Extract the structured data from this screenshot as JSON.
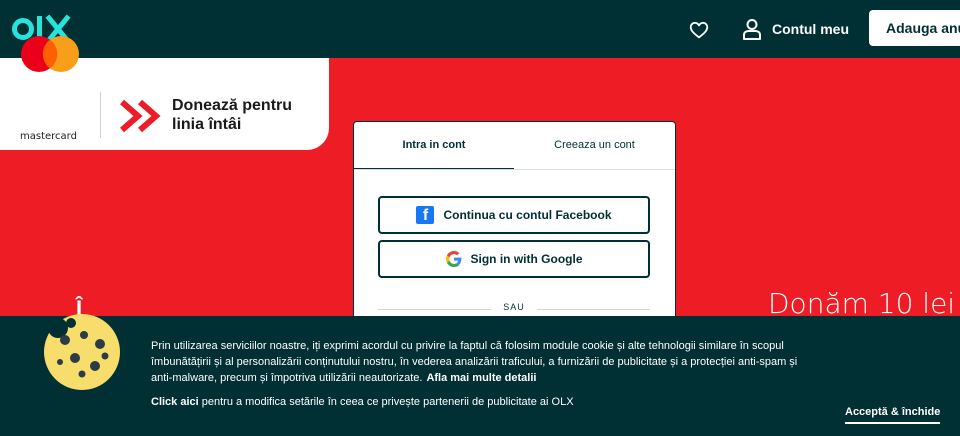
{
  "header": {
    "logo_alt": "olx-logo",
    "favorites_icon": "heart-icon",
    "account_icon": "user-icon",
    "account_label": "Contul meu",
    "post_ad_label": "Adauga anunt"
  },
  "banner": {
    "sponsor_name": "mastercard",
    "campaign_text": "Donează pentru linia întâi",
    "headline_partial": "Î",
    "right_text": "Donăm 10 lei"
  },
  "login": {
    "tabs": [
      {
        "label": "Intra in cont",
        "active": true
      },
      {
        "label": "Creeaza un cont",
        "active": false
      }
    ],
    "facebook_label": "Continua cu contul Facebook",
    "google_label": "Sign in with Google",
    "divider_label": "SAU"
  },
  "cookie_banner": {
    "text": "Prin utilizarea serviciilor noastre, iți exprimi acordul cu privire la faptul că folosim module cookie și alte tehnologii similare în scopul îmbunătățirii și al personalizării conținutului nostru, în vederea analizării traficului, a furnizării de publicitate și a protecției anti-spam și anti-malware, precum și împotriva utilizării neautorizate.",
    "more_details_label": "Afla mai multe detalii",
    "click_here_label": "Click aici",
    "click_here_suffix": "pentru a modifica setările în ceea ce privește partenerii de publicitate ai OLX",
    "accept_label": "Acceptă & închide"
  },
  "colors": {
    "brand_dark": "#002f34",
    "brand_teal": "#23e5db",
    "campaign_red": "#ee1c25",
    "facebook_blue": "#1877f2",
    "mastercard_red": "#eb001b",
    "mastercard_orange": "#f79e1b"
  }
}
